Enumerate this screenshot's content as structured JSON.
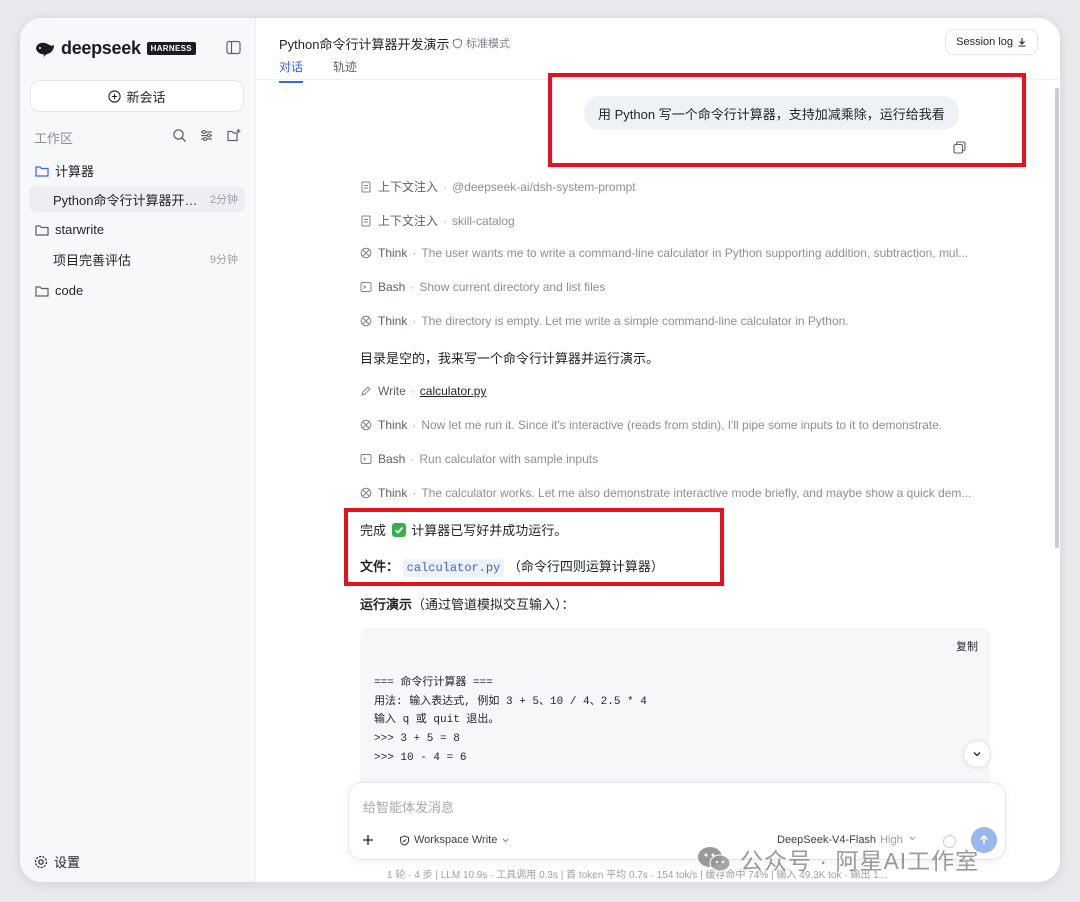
{
  "app": {
    "brand": "deepseek",
    "badge": "HARNESS"
  },
  "sidebar": {
    "new_chat": "新会话",
    "workspace_label": "工作区",
    "folders": [
      {
        "name": "计算器",
        "items": [
          {
            "label": "Python命令行计算器开发演...",
            "time": "2分钟",
            "active": true
          }
        ]
      },
      {
        "name": "starwrite",
        "items": [
          {
            "label": "项目完善评估",
            "time": "9分钟",
            "active": false
          }
        ]
      },
      {
        "name": "code",
        "items": []
      }
    ],
    "settings": "设置"
  },
  "header": {
    "title": "Python命令行计算器开发演示",
    "mode": "标准模式",
    "tabs": [
      {
        "label": "对话",
        "active": true
      },
      {
        "label": "轨迹",
        "active": false
      }
    ],
    "session_log": "Session log"
  },
  "conversation": {
    "user_message": "用 Python 写一个命令行计算器，支持加减乘除，运行给我看",
    "steps_a": [
      {
        "icon": "doc-icon",
        "kind": "上下文注入",
        "detail": "@deepseek-ai/dsh-system-prompt"
      },
      {
        "icon": "doc-icon",
        "kind": "上下文注入",
        "detail": "skill-catalog"
      },
      {
        "icon": "think-icon",
        "kind": "Think",
        "detail": "The user wants me to write a command-line calculator in Python supporting addition, subtraction, mul..."
      },
      {
        "icon": "terminal-icon",
        "kind": "Bash",
        "detail": "Show current directory and list files"
      },
      {
        "icon": "think-icon",
        "kind": "Think",
        "detail": "The directory is empty. Let me write a simple command-line calculator in Python."
      }
    ],
    "assistant_text_1": "目录是空的，我来写一个命令行计算器并运行演示。",
    "write_step": {
      "kind": "Write",
      "file": "calculator.py"
    },
    "steps_b": [
      {
        "icon": "think-icon",
        "kind": "Think",
        "detail": "Now let me run it. Since it's interactive (reads from stdin), I'll pipe some inputs to it to demonstrate."
      },
      {
        "icon": "terminal-icon",
        "kind": "Bash",
        "detail": "Run calculator with sample inputs"
      },
      {
        "icon": "think-icon",
        "kind": "Think",
        "detail": "The calculator works. Let me also demonstrate interactive mode briefly, and maybe show a quick dem..."
      }
    ],
    "done_prefix": "完成",
    "done_text": "计算器已写好并成功运行。",
    "file_label": "文件：",
    "file_name": "calculator.py",
    "file_desc": "（命令行四则运算计算器）",
    "demo_label": "运行演示",
    "demo_desc": "（通过管道模拟交互输入）：",
    "code": {
      "copy": "复制",
      "lines": [
        "=== 命令行计算器 ===",
        "用法: 输入表达式, 例如 3 + 5、10 / 4、2.5 * 4",
        "输入 q 或 quit 退出。",
        "",
        ">>> 3 + 5 = 8",
        ">>> 10 - 4 = 6"
      ]
    }
  },
  "composer": {
    "placeholder": "给智能体发消息",
    "permission": "Workspace Write",
    "model": "DeepSeek-V4-Flash",
    "level": "High",
    "status": "1 轮 · 4 步  |  LLM 10.9s · 工具调用 0.3s  |  首 token 平均 0.7s · 154 tok/s  |  缓存命中 74%  |  输入 49.3K tok · 输出 1..."
  },
  "watermark": "公众号 · 阿星AI工作室"
}
